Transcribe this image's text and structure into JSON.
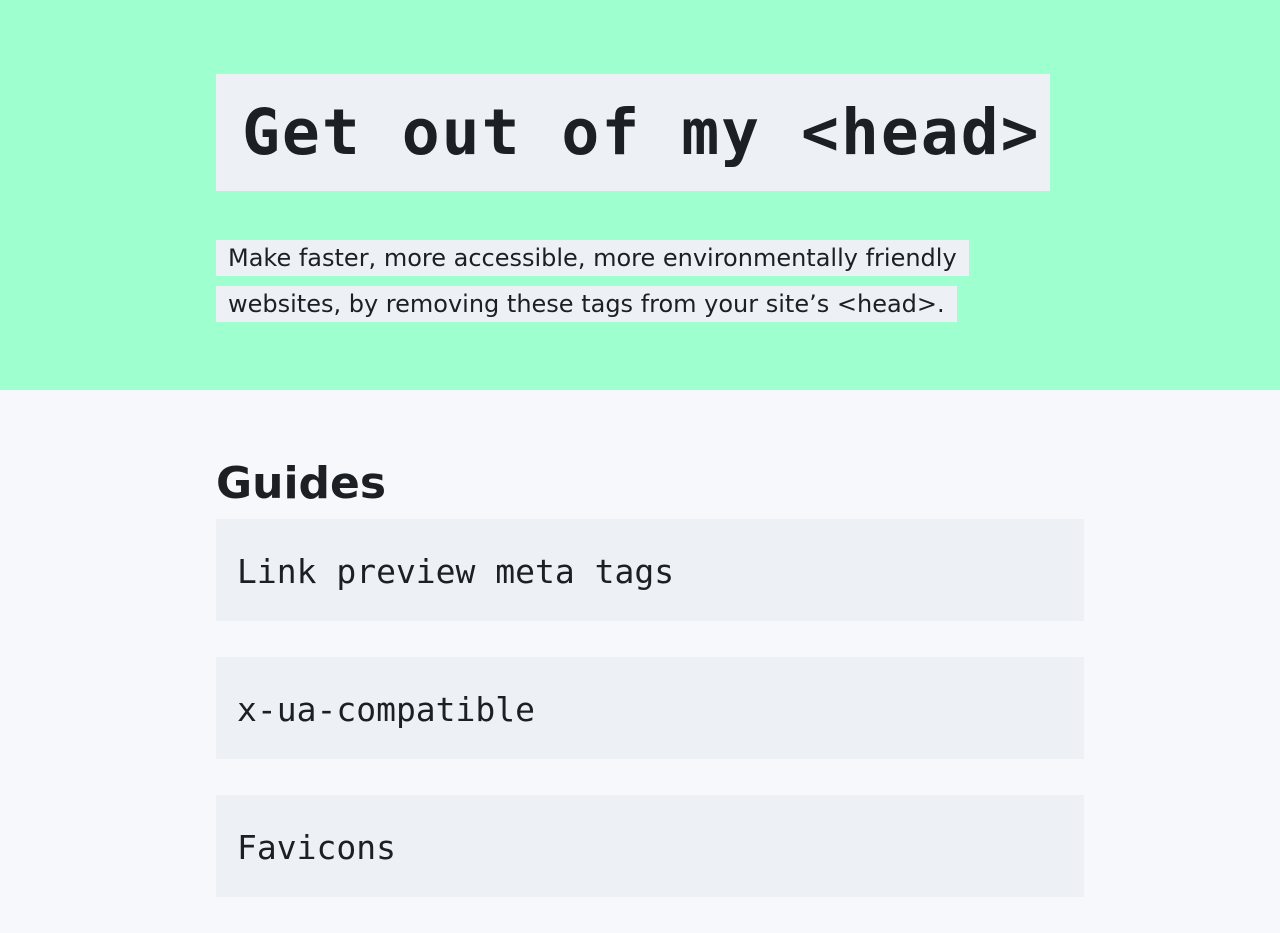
{
  "hero": {
    "title": "Get out of my <head>",
    "subtitle_line1": "Make faster, more accessible, more environmentally friendly",
    "subtitle_line2": "websites, by removing these tags from your site’s <head>."
  },
  "guides": {
    "heading": "Guides",
    "items": [
      {
        "label": "Link preview meta tags"
      },
      {
        "label": "x-ua-compatible"
      },
      {
        "label": "Favicons"
      }
    ]
  },
  "colors": {
    "hero_background": "#9effcf",
    "box_background": "#edf1f6",
    "page_background": "#f6f8fc",
    "text": "#1c1f24"
  }
}
